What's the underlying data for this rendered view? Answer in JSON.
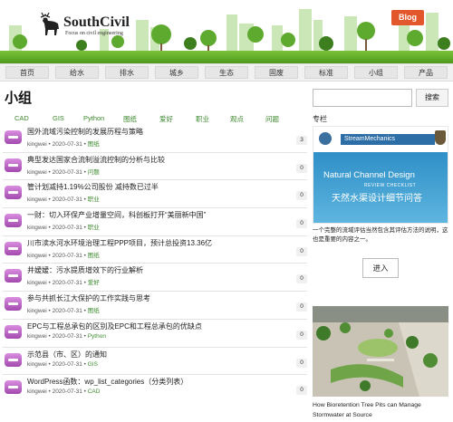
{
  "site": {
    "name": "SouthCivil",
    "tagline": "Focus on civil engineering",
    "blog_label": "Blog"
  },
  "nav": [
    "首页",
    "给水",
    "排水",
    "城乡",
    "生态",
    "固废",
    "标准",
    "小组",
    "产品"
  ],
  "page_title": "小组",
  "tags": [
    "CAD",
    "GIS",
    "Python",
    "图纸",
    "爱好",
    "职业",
    "观点",
    "问题"
  ],
  "topics": [
    {
      "title": "国外流域污染控制的发展历程与策略",
      "author": "kingwei",
      "date": "2020-07-31",
      "category": "图纸",
      "count": "3"
    },
    {
      "title": "典型发达国家合流制溢流控制的分析与比较",
      "author": "kingwei",
      "date": "2020-07-31",
      "category": "问题",
      "count": "0"
    },
    {
      "title": "管计划减持1.19%公司股份 减持数已过半",
      "author": "kingwei",
      "date": "2020-07-31",
      "category": "职业",
      "count": "0"
    },
    {
      "title": "一财：切入环保产业增量空间，科创板打开“美丽新中国”",
      "author": "kingwei",
      "date": "2020-07-31",
      "category": "职业",
      "count": "0"
    },
    {
      "title": "川市渎水河水环境治理工程PPP项目，预计总投资13.36亿",
      "author": "kingwei",
      "date": "2020-07-31",
      "category": "图纸",
      "count": "0"
    },
    {
      "title": "井嫒嫒：污水提质增效下的行业解析",
      "author": "kingwei",
      "date": "2020-07-31",
      "category": "爱好",
      "count": "0"
    },
    {
      "title": "参与共抓长江大保护的工作实践与思考",
      "author": "kingwei",
      "date": "2020-07-31",
      "category": "图纸",
      "count": "0"
    },
    {
      "title": "EPC与工程总承包的区别及EPC和工程总承包的优缺点",
      "author": "kingwei",
      "date": "2020-07-31",
      "category": "Python",
      "count": "0"
    },
    {
      "title": "示范县（市、区）的通知",
      "author": "kingwei",
      "date": "2020-07-31",
      "category": "GIS",
      "count": "0"
    },
    {
      "title": "WordPress函数：wp_list_categories（分类列表）",
      "author": "kingwei",
      "date": "2020-07-31",
      "category": "CAD",
      "count": "0"
    }
  ],
  "sidebar": {
    "search_button": "搜索",
    "column_title": "专栏",
    "ad1": {
      "brand": "StreamMechanics",
      "line1": "Natural Channel Design",
      "line2": "REVIEW CHECKLIST",
      "line3": "天然水渠设计细节问答",
      "caption": "一个完整的流域评估当然包含其评估方法的说明，这也是重要的内容之一。"
    },
    "enter_button": "进入",
    "ad2": {
      "caption": "How Bioretention Tree Pits can Manage Stormwater at Source"
    }
  },
  "colors": {
    "accent_green": "#3c8a2e",
    "blog_orange": "#e2572c",
    "avatar_purple": "#b55cbf",
    "ad_blue": "#2f8fc7"
  }
}
